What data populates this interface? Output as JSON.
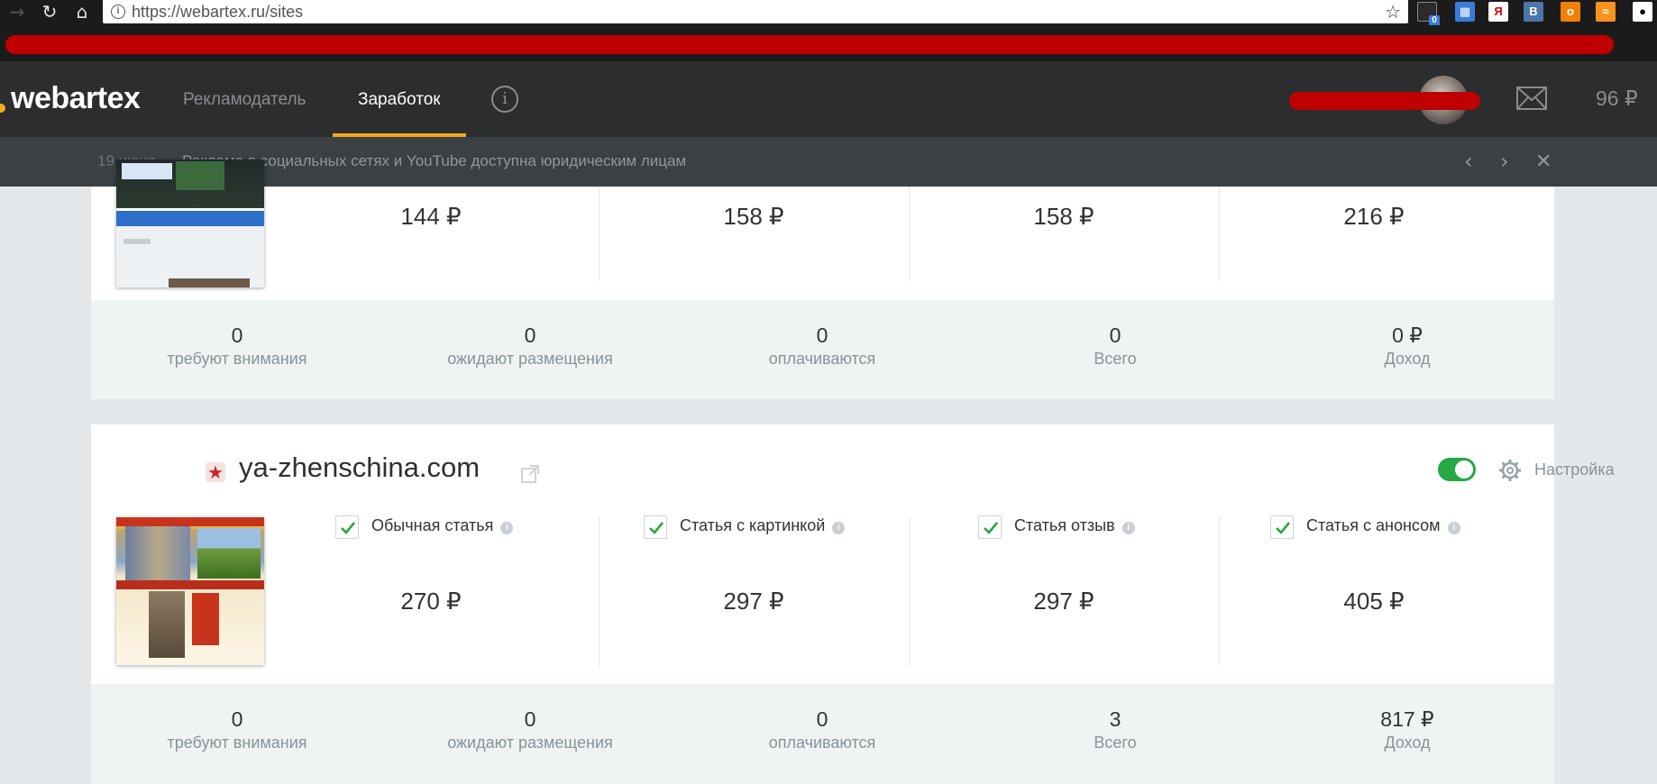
{
  "browser": {
    "back_icon": "arrow-left-icon",
    "reload_icon": "reload-icon",
    "home_icon": "home-icon",
    "url": "https://webartex.ru/sites",
    "extension_badge": "0"
  },
  "header": {
    "logo": "webartex",
    "nav": [
      {
        "label": "Рекламодатель",
        "active": false
      },
      {
        "label": "Заработок",
        "active": true
      }
    ],
    "balance": "96 ₽"
  },
  "notice": {
    "date": "19 июня",
    "text": "Реклама в социальных сетях и YouTube доступна юридическим лицам"
  },
  "site1": {
    "prices": [
      "144 ₽",
      "158 ₽",
      "158 ₽",
      "216 ₽"
    ],
    "stats": [
      {
        "value": "0",
        "label": "требуют внимания"
      },
      {
        "value": "0",
        "label": "ожидают размещения"
      },
      {
        "value": "0",
        "label": "оплачиваются"
      },
      {
        "value": "0",
        "label": "Всего"
      },
      {
        "value": "0 ₽",
        "label": "Доход"
      }
    ]
  },
  "site2": {
    "domain": "ya-zhenschina.com",
    "enabled": true,
    "settings_label": "Настройка",
    "types": [
      {
        "label": "Обычная статья",
        "checked": true,
        "price": "270 ₽"
      },
      {
        "label": "Статья с картинкой",
        "checked": true,
        "price": "297 ₽"
      },
      {
        "label": "Статья отзыв",
        "checked": true,
        "price": "297 ₽"
      },
      {
        "label": "Статья с анонсом",
        "checked": true,
        "price": "405 ₽"
      }
    ],
    "stats": [
      {
        "value": "0",
        "label": "требуют внимания"
      },
      {
        "value": "0",
        "label": "ожидают размещения"
      },
      {
        "value": "0",
        "label": "оплачиваются"
      },
      {
        "value": "3",
        "label": "Всего"
      },
      {
        "value": "817 ₽",
        "label": "Доход"
      }
    ]
  },
  "colors": {
    "accent": "#f7a821",
    "toggle_on": "#28a745",
    "header_bg": "#2b2d2f",
    "redaction": "#c00000"
  }
}
